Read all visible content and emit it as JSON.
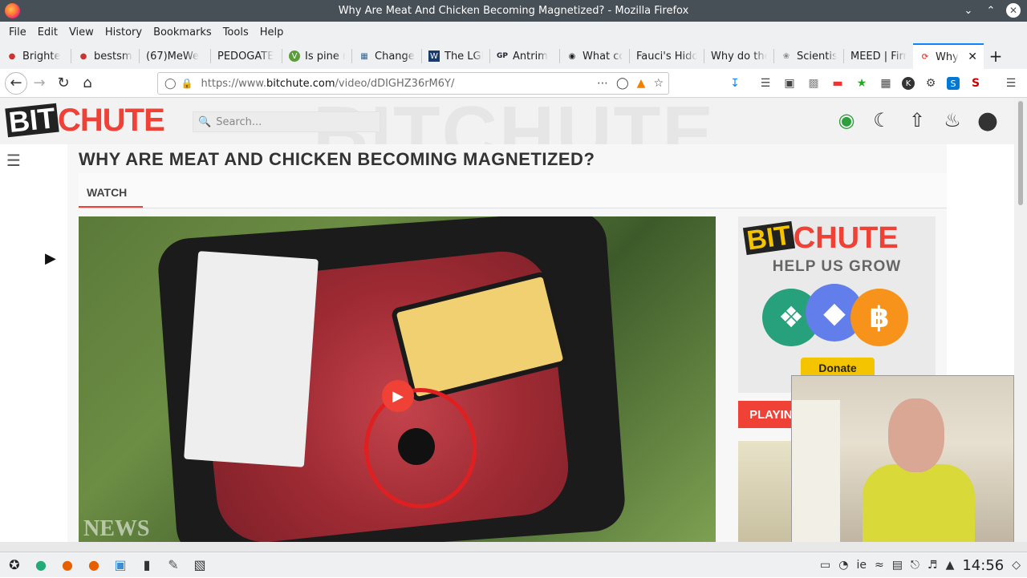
{
  "window": {
    "title": "Why Are Meat And Chicken Becoming Magnetized? - Mozilla Firefox"
  },
  "menu": [
    "File",
    "Edit",
    "View",
    "History",
    "Bookmarks",
    "Tools",
    "Help"
  ],
  "tabs": [
    {
      "label": "Brighte",
      "icon": "dot-icon"
    },
    {
      "label": "bestsma",
      "icon": "dot-icon"
    },
    {
      "label": "(67)MeWe",
      "icon": ""
    },
    {
      "label": "PEDOGATE",
      "icon": ""
    },
    {
      "label": "Is pine n",
      "icon": "v-icon"
    },
    {
      "label": "Change",
      "icon": "chart-icon"
    },
    {
      "label": "The LGB",
      "icon": "w-icon"
    },
    {
      "label": "Antrim",
      "icon": "gp-icon"
    },
    {
      "label": "What co",
      "icon": "q-icon"
    },
    {
      "label": "Fauci's Hidd",
      "icon": ""
    },
    {
      "label": "Why do the",
      "icon": ""
    },
    {
      "label": "Scientis",
      "icon": "leaf-icon"
    },
    {
      "label": "MEED | Firm",
      "icon": ""
    },
    {
      "label": "Why",
      "icon": "bitchute-icon",
      "active": true
    }
  ],
  "nav": {
    "url_prefix": "https://www.",
    "url_domain": "bitchute.com",
    "url_path": "/video/dDIGHZ36rM6Y/"
  },
  "site": {
    "logo_bit": "BIT",
    "logo_chute": "CHUTE",
    "bg_text": "BITCHUTE",
    "search_placeholder": "Search..."
  },
  "video": {
    "title": "WHY ARE MEAT AND CHICKEN BECOMING MAGNETIZED?",
    "watch_tab": "WATCH",
    "news_overlay": "NEWS"
  },
  "sidebar": {
    "logo_bit": "BIT",
    "logo_chute": "CHUTE",
    "help_text": "HELP US GROW",
    "donate_label": "Donate",
    "playing_label": "PLAYIN"
  },
  "taskbar": {
    "keyboard_layout": "ie",
    "clock": "14:56"
  },
  "colors": {
    "accent": "#ef4136",
    "titlebar": "#475057",
    "donate": "#f5c400"
  }
}
